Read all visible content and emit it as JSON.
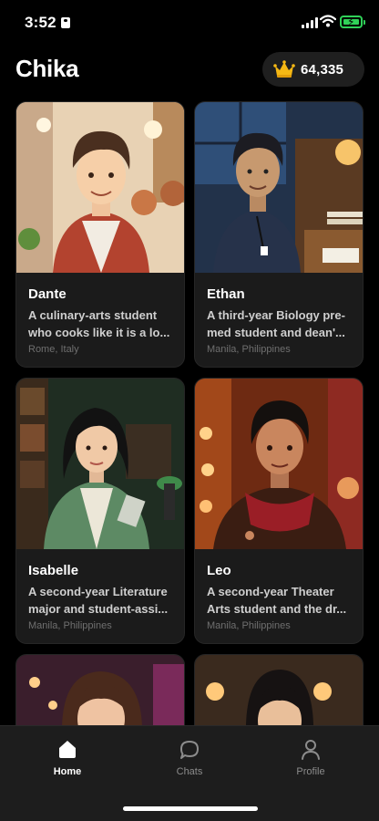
{
  "status": {
    "time": "3:52"
  },
  "header": {
    "title": "Chika",
    "coins": "64,335"
  },
  "colors": {
    "background": "#000000",
    "card": "#1b1b1b",
    "accent_gold": "#f5b814",
    "battery": "#30d158"
  },
  "characters": [
    {
      "name": "Dante",
      "description": "A culinary-arts student who cooks like it is a lo...",
      "location": "Rome, Italy"
    },
    {
      "name": "Ethan",
      "description": "A third-year Biology pre-med student and dean'...",
      "location": "Manila, Philippines"
    },
    {
      "name": "Isabelle",
      "description": "A second-year Literature major and student-assi...",
      "location": "Manila, Philippines"
    },
    {
      "name": "Leo",
      "description": "A second-year Theater Arts student and the dr...",
      "location": "Manila, Philippines"
    }
  ],
  "nav": {
    "home": "Home",
    "chats": "Chats",
    "profile": "Profile"
  },
  "icons": {
    "status_id": "id-card-icon",
    "signal": "signal-icon",
    "wifi": "wifi-icon",
    "battery": "battery-charging-icon",
    "coins": "crown-icon",
    "home": "home-icon",
    "chats": "chat-bubble-icon",
    "profile": "person-icon"
  }
}
